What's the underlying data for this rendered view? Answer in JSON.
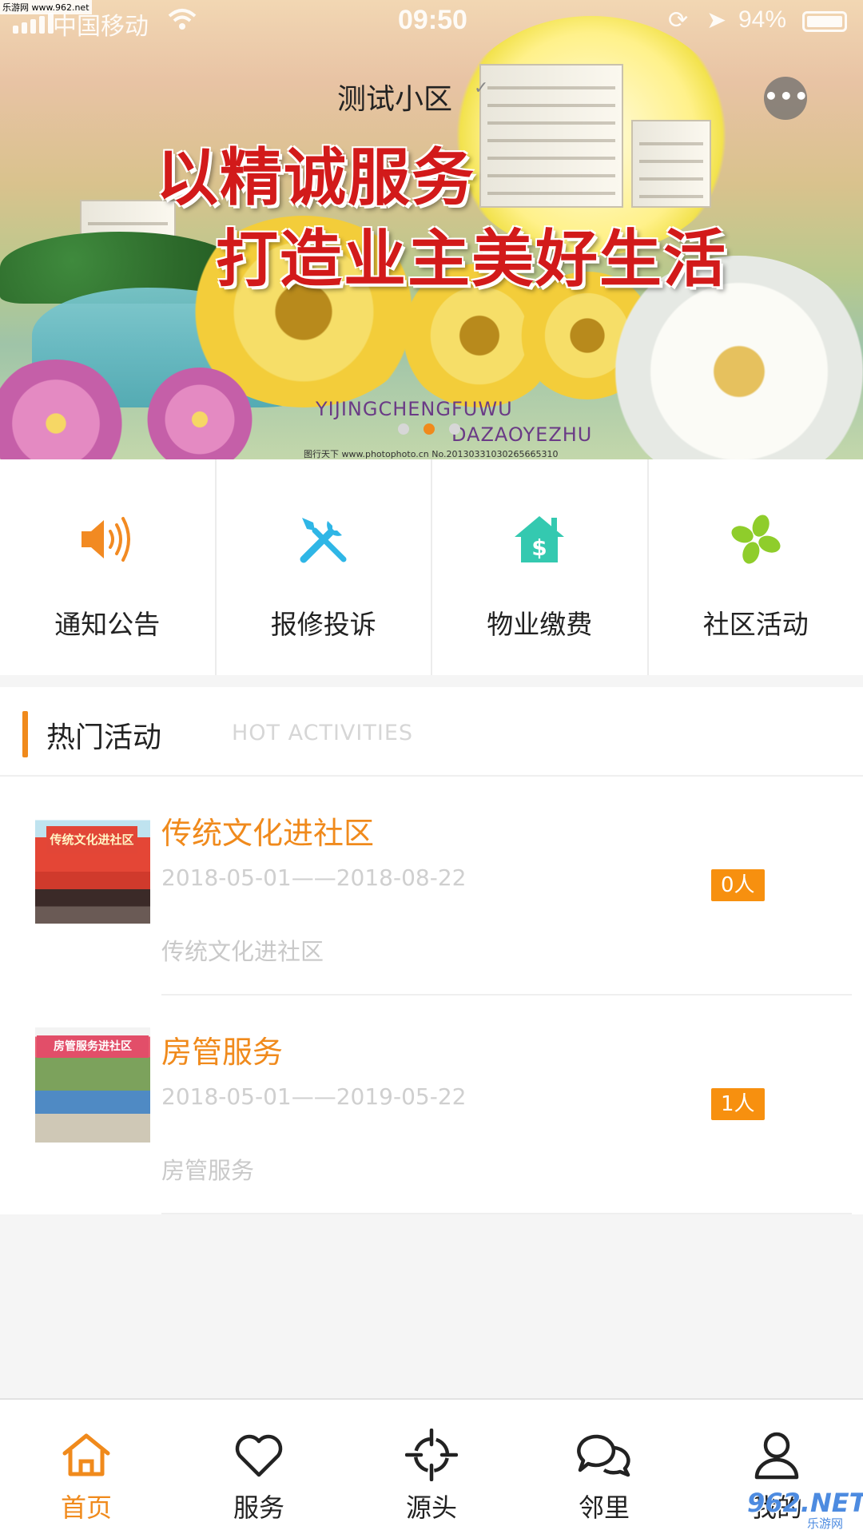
{
  "status_bar": {
    "carrier": "中国移动",
    "time": "09:50",
    "battery": "94%"
  },
  "site_tag": "乐游网 www.962.net",
  "banner": {
    "community_name": "测试小区",
    "slogan_line1": "以精诚服务",
    "slogan_line2": "打造业主美好生活",
    "pinyin_line1": "YIJINGCHENGFUWU",
    "pinyin_line2": "DAZAOYEZHU",
    "image_credit": "图行天下 www.photophoto.cn No.20130331030265665310",
    "more_label": "•••",
    "slide_count": 3,
    "active_slide": 2
  },
  "quick_menu": [
    {
      "label": "通知公告",
      "icon": "speaker-icon",
      "color": "#f28a22"
    },
    {
      "label": "报修投诉",
      "icon": "repair-tools-icon",
      "color": "#2fb6e6"
    },
    {
      "label": "物业缴费",
      "icon": "house-dollar-icon",
      "color": "#34c9b0"
    },
    {
      "label": "社区活动",
      "icon": "pinwheel-icon",
      "color": "#8fcd2b"
    }
  ],
  "hot_activities": {
    "title": "热门活动",
    "subtitle": "HOT ACTIVITIES",
    "items": [
      {
        "title": "传统文化进社区",
        "date_range": "2018-05-01——2018-08-22",
        "participants": "0人",
        "description": "传统文化进社区",
        "thumb_caption": "传统文化进社区"
      },
      {
        "title": "房管服务",
        "date_range": "2018-05-01——2019-05-22",
        "participants": "1人",
        "description": "房管服务",
        "thumb_caption": "房管服务进社区"
      }
    ]
  },
  "tabbar": {
    "tabs": [
      {
        "label": "首页",
        "icon": "home-icon",
        "active": true
      },
      {
        "label": "服务",
        "icon": "heart-icon",
        "active": false
      },
      {
        "label": "源头",
        "icon": "crosshair-icon",
        "active": false
      },
      {
        "label": "邻里",
        "icon": "chat-bubbles-icon",
        "active": false
      },
      {
        "label": "我的",
        "icon": "user-icon",
        "active": false
      }
    ]
  },
  "corner_watermark": {
    "logo": "962.NET",
    "sub": "乐游网"
  },
  "colors": {
    "accent": "#f08a1c",
    "badge": "#f7900f",
    "muted_text": "#cfcfcf"
  }
}
